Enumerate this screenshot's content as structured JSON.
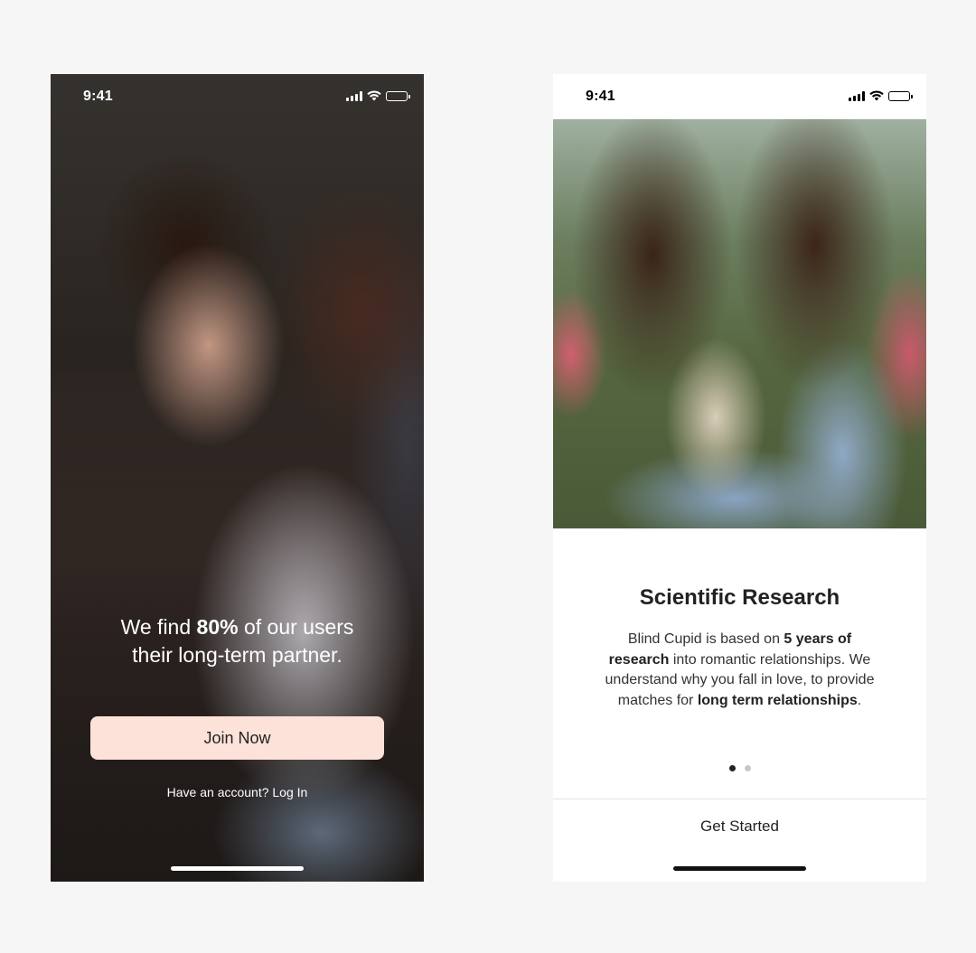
{
  "screen1": {
    "status": {
      "time": "9:41"
    },
    "headline": {
      "prefix": "We find ",
      "highlight": "80%",
      "suffix": " of our users",
      "line2": "their long-term partner."
    },
    "join_label": "Join Now",
    "login_line": "Have an account? Log In",
    "colors": {
      "button_bg": "#fde2da",
      "text": "#ffffff"
    }
  },
  "screen2": {
    "status": {
      "time": "9:41"
    },
    "title": "Scientific Research",
    "body": {
      "p1": "Blind Cupid is based on ",
      "b1": "5 years of research",
      "p2": " into romantic relationships. We understand why you fall in love, to provide matches for ",
      "b2": "long term relationships",
      "p3": "."
    },
    "pagination": {
      "current": 1,
      "total": 2
    },
    "cta_label": "Get Started"
  }
}
